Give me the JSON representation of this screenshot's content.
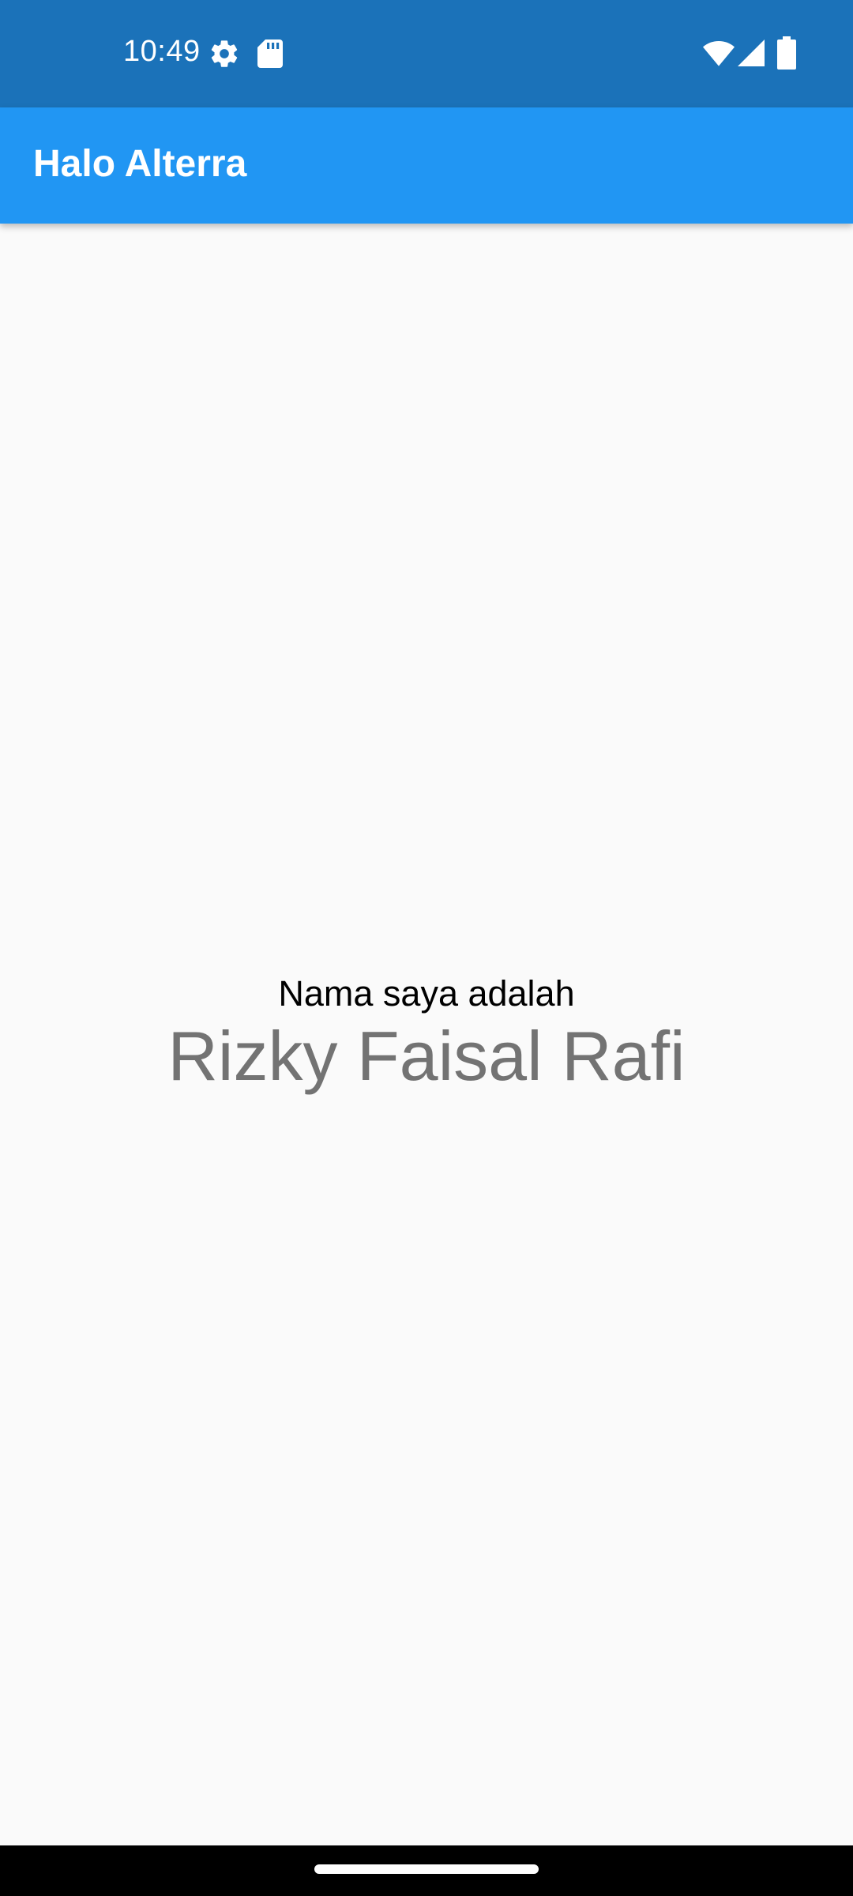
{
  "status_bar": {
    "time": "10:49",
    "icons_left": [
      "settings-gear-icon",
      "sd-card-icon"
    ],
    "icons_right": [
      "wifi-icon",
      "cellular-signal-icon",
      "battery-icon"
    ],
    "background_color": "#1b72b9"
  },
  "app_bar": {
    "title": "Halo Alterra",
    "background_color": "#2196f3"
  },
  "main": {
    "intro": "Nama saya adalah",
    "name": "Rizky Faisal Rafi"
  },
  "navigation_bar": {
    "handle": "home-gesture-handle"
  }
}
